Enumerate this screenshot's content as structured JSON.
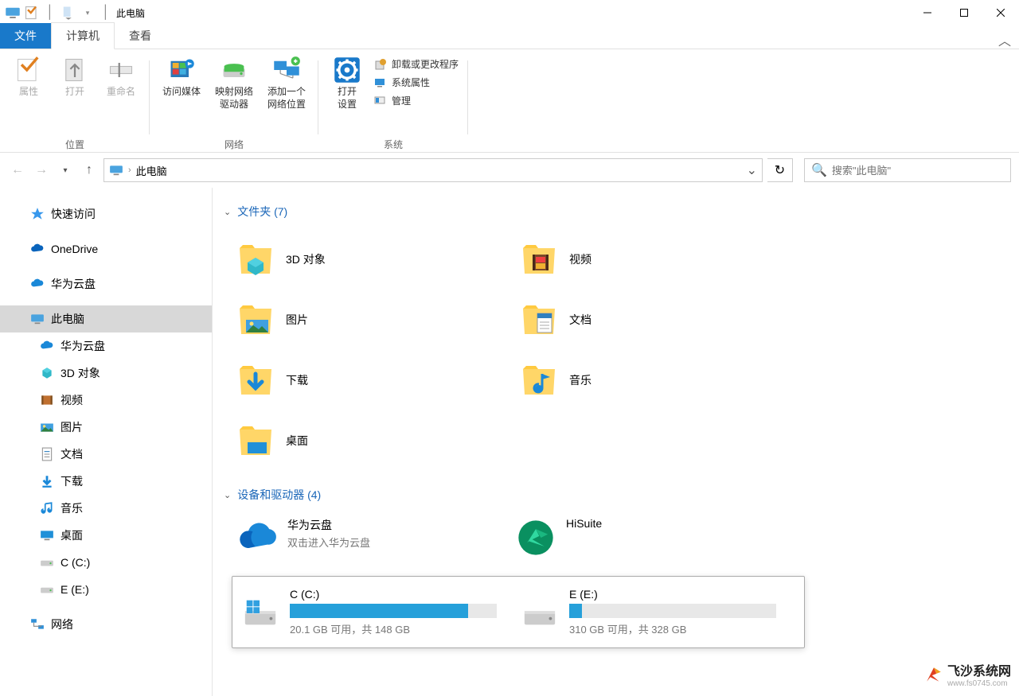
{
  "window": {
    "title": "此电脑"
  },
  "ribbon": {
    "tabs": {
      "file": "文件",
      "computer": "计算机",
      "view": "查看"
    },
    "groups": {
      "location": {
        "label": "位置",
        "properties": "属性",
        "open": "打开",
        "rename": "重命名"
      },
      "network": {
        "label": "网络",
        "access_media": "访问媒体",
        "map_drive": "映射网络\n驱动器",
        "add_location": "添加一个\n网络位置"
      },
      "system": {
        "label": "系统",
        "open_settings": "打开\n设置",
        "uninstall": "卸载或更改程序",
        "sys_props": "系统属性",
        "manage": "管理"
      }
    }
  },
  "nav": {
    "breadcrumb": "此电脑",
    "search_placeholder": "搜索\"此电脑\""
  },
  "sidebar": {
    "quick_access": "快速访问",
    "onedrive": "OneDrive",
    "huawei_cloud": "华为云盘",
    "this_pc": "此电脑",
    "items": [
      {
        "label": "华为云盘",
        "icon": "cloud"
      },
      {
        "label": "3D 对象",
        "icon": "3d"
      },
      {
        "label": "视频",
        "icon": "video"
      },
      {
        "label": "图片",
        "icon": "picture"
      },
      {
        "label": "文档",
        "icon": "document"
      },
      {
        "label": "下载",
        "icon": "download"
      },
      {
        "label": "音乐",
        "icon": "music"
      },
      {
        "label": "桌面",
        "icon": "desktop"
      },
      {
        "label": "C (C:)",
        "icon": "drive"
      },
      {
        "label": "E  (E:)",
        "icon": "drive"
      }
    ],
    "network": "网络"
  },
  "content": {
    "folders_header": "文件夹 (7)",
    "folders": [
      {
        "label": "3D 对象",
        "icon": "3d"
      },
      {
        "label": "视频",
        "icon": "video"
      },
      {
        "label": "图片",
        "icon": "picture"
      },
      {
        "label": "文档",
        "icon": "document"
      },
      {
        "label": "下载",
        "icon": "download"
      },
      {
        "label": "音乐",
        "icon": "music"
      },
      {
        "label": "桌面",
        "icon": "desktop"
      }
    ],
    "devices_header": "设备和驱动器 (4)",
    "devices": [
      {
        "label": "华为云盘",
        "sub": "双击进入华为云盘",
        "icon": "cloud"
      },
      {
        "label": "HiSuite",
        "sub": "",
        "icon": "hisuite"
      }
    ],
    "drives": [
      {
        "label": "C (C:)",
        "free": "20.1 GB 可用，共 148 GB",
        "fill_pct": 86,
        "icon": "winvol"
      },
      {
        "label": "E  (E:)",
        "free": "310 GB 可用，共 328 GB",
        "fill_pct": 6,
        "icon": "drive"
      }
    ]
  },
  "watermark": {
    "text": "飞沙系统网",
    "url": "www.fs0745.com"
  }
}
